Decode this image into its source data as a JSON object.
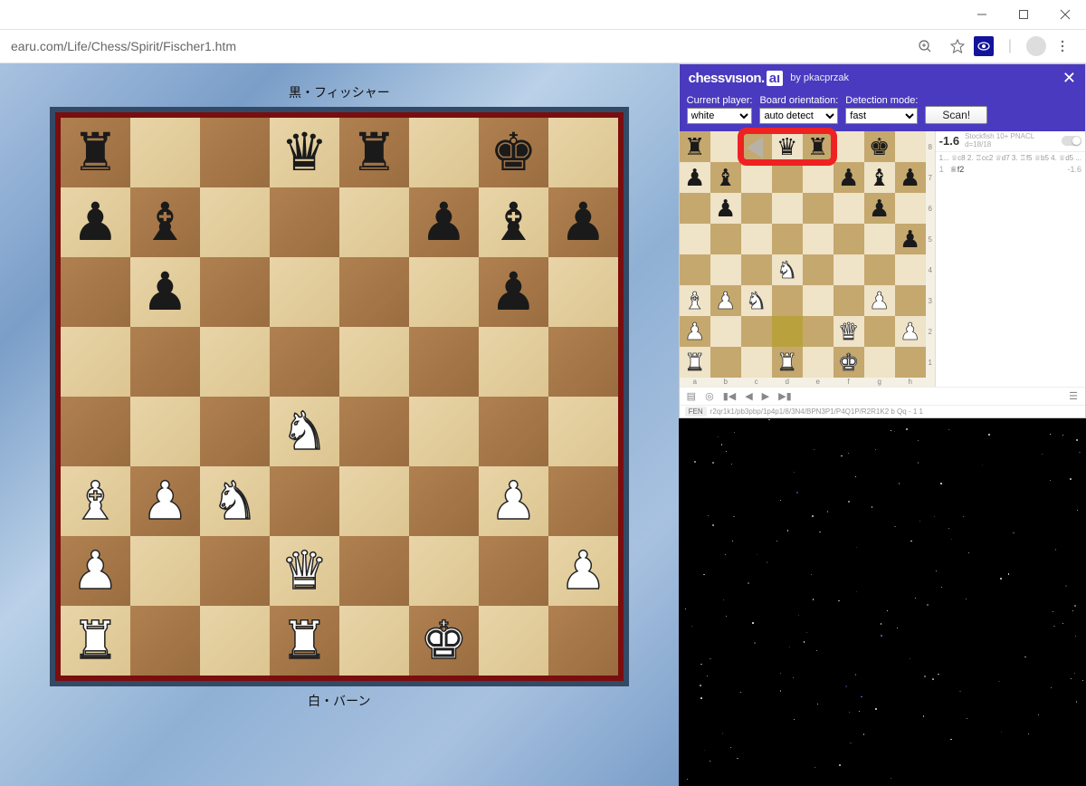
{
  "url": "earu.com/Life/Chess/Spirit/Fischer1.htm",
  "players": {
    "black": "黒・フィッシャー",
    "white": "白・バーン"
  },
  "main_board": {
    "light": "#e8d4a8",
    "dark": "#b08050",
    "pieces": [
      {
        "sq": "a8",
        "p": "r",
        "c": "b"
      },
      {
        "sq": "d8",
        "p": "q",
        "c": "b"
      },
      {
        "sq": "e8",
        "p": "r",
        "c": "b"
      },
      {
        "sq": "g8",
        "p": "k",
        "c": "b"
      },
      {
        "sq": "a7",
        "p": "p",
        "c": "b"
      },
      {
        "sq": "b7",
        "p": "b",
        "c": "b"
      },
      {
        "sq": "f7",
        "p": "p",
        "c": "b"
      },
      {
        "sq": "g7",
        "p": "b",
        "c": "b"
      },
      {
        "sq": "h7",
        "p": "p",
        "c": "b"
      },
      {
        "sq": "b6",
        "p": "p",
        "c": "b"
      },
      {
        "sq": "g6",
        "p": "p",
        "c": "b"
      },
      {
        "sq": "d4",
        "p": "n",
        "c": "w"
      },
      {
        "sq": "a3",
        "p": "b",
        "c": "w"
      },
      {
        "sq": "b3",
        "p": "p",
        "c": "w"
      },
      {
        "sq": "c3",
        "p": "n",
        "c": "w"
      },
      {
        "sq": "g3",
        "p": "p",
        "c": "w"
      },
      {
        "sq": "a2",
        "p": "p",
        "c": "w"
      },
      {
        "sq": "d2",
        "p": "q",
        "c": "w"
      },
      {
        "sq": "h2",
        "p": "p",
        "c": "w"
      },
      {
        "sq": "a1",
        "p": "r",
        "c": "w"
      },
      {
        "sq": "d1",
        "p": "r",
        "c": "w"
      },
      {
        "sq": "f1",
        "p": "k",
        "c": "w"
      }
    ]
  },
  "ext": {
    "brand_pre": "chessvısıon.",
    "brand_suf": "aı",
    "by": "by pkacprzak",
    "labels": {
      "player": "Current player:",
      "orient": "Board orientation:",
      "mode": "Detection mode:"
    },
    "values": {
      "player": "white",
      "orient": "auto detect",
      "mode": "fast"
    },
    "scan": "Scan!",
    "mini_board": {
      "highlight": "d2",
      "pieces": [
        {
          "sq": "a8",
          "p": "r",
          "c": "b"
        },
        {
          "sq": "d8",
          "p": "q",
          "c": "b"
        },
        {
          "sq": "e8",
          "p": "r",
          "c": "b"
        },
        {
          "sq": "g8",
          "p": "k",
          "c": "b"
        },
        {
          "sq": "a7",
          "p": "p",
          "c": "b"
        },
        {
          "sq": "b7",
          "p": "b",
          "c": "b"
        },
        {
          "sq": "f7",
          "p": "p",
          "c": "b"
        },
        {
          "sq": "g7",
          "p": "b",
          "c": "b"
        },
        {
          "sq": "h7",
          "p": "p",
          "c": "b"
        },
        {
          "sq": "b6",
          "p": "p",
          "c": "b"
        },
        {
          "sq": "g6",
          "p": "p",
          "c": "b"
        },
        {
          "sq": "h5",
          "p": "p",
          "c": "b"
        },
        {
          "sq": "d4",
          "p": "n",
          "c": "w"
        },
        {
          "sq": "a3",
          "p": "b",
          "c": "w"
        },
        {
          "sq": "b3",
          "p": "p",
          "c": "w"
        },
        {
          "sq": "c3",
          "p": "n",
          "c": "w"
        },
        {
          "sq": "g3",
          "p": "p",
          "c": "w"
        },
        {
          "sq": "a2",
          "p": "p",
          "c": "w"
        },
        {
          "sq": "f2",
          "p": "q",
          "c": "w"
        },
        {
          "sq": "h2",
          "p": "p",
          "c": "w"
        },
        {
          "sq": "a1",
          "p": "r",
          "c": "w"
        },
        {
          "sq": "d1",
          "p": "r",
          "c": "w"
        },
        {
          "sq": "f1",
          "p": "k",
          "c": "w"
        }
      ],
      "red_box": {
        "file_from": "c",
        "file_to": "e",
        "rank": "8"
      }
    },
    "analysis": {
      "eval": "-1.6",
      "engine": "Stockfish 10+ PNACL",
      "depth": "d=18/18",
      "pv": "1... ♕c8 2. ♖cc2 ♕d7 3. ♖f5 ♕b5 4. ♕d5 ...",
      "moves": [
        {
          "n": "1",
          "san": "♕f2",
          "eval": "-1.6"
        }
      ]
    },
    "fen_label": "FEN",
    "fen": "r2qr1k1/pb3pbp/1p4p1/8/3N4/BPN3P1/P4Q1P/R2R1K2 b Qq - 1 1"
  },
  "glyphs": {
    "k": "♚",
    "q": "♛",
    "r": "♜",
    "b": "♝",
    "n": "♞",
    "p": "♟"
  }
}
